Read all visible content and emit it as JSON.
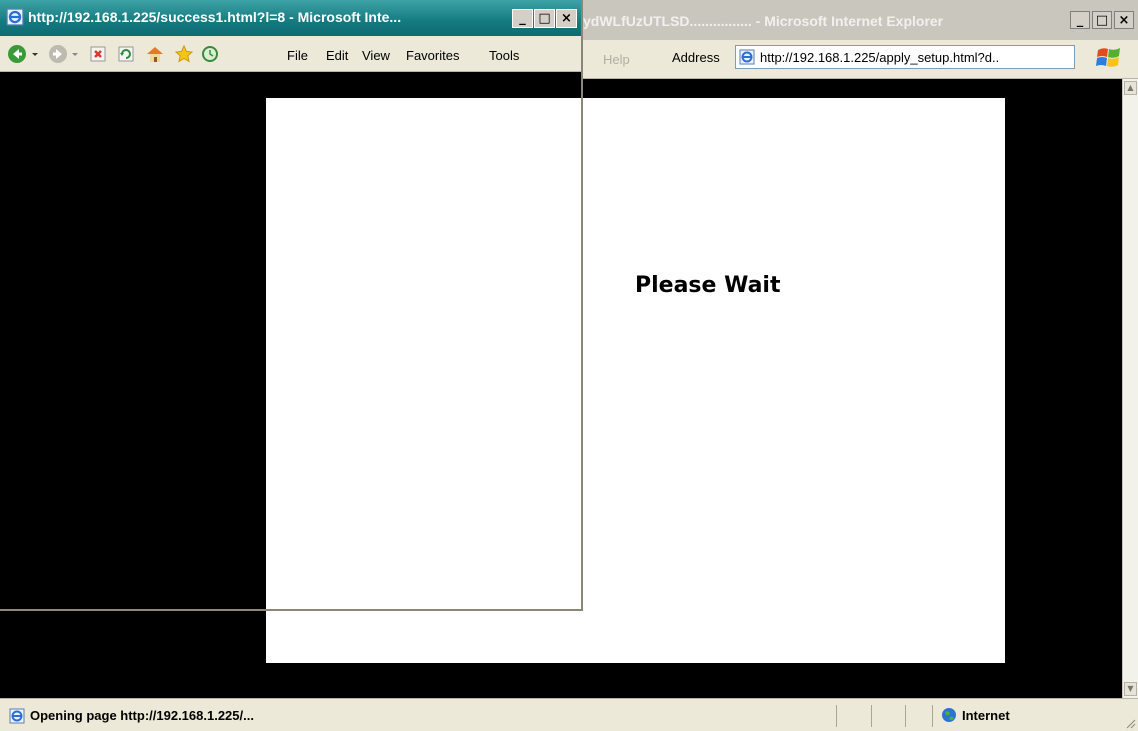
{
  "background_window": {
    "title": "ydWLfUzUTLSD................ - Microsoft Internet Explorer",
    "controls": [
      "_",
      "□",
      "×"
    ],
    "menu": [
      {
        "label": "Help",
        "dim": true
      }
    ],
    "address_label": "Address",
    "address_value": "http://192.168.1.225/apply_setup.html?d..",
    "content_message": "Please Wait",
    "status_text": "Opening page http://192.168.1.225/...",
    "zone_text": "Internet"
  },
  "popup_window": {
    "title": "http://192.168.1.225/success1.html?l=8 - Microsoft Inte...",
    "controls": [
      "_",
      "□",
      "×"
    ],
    "menu": [
      "File",
      "Edit",
      "View",
      "Favorites",
      "Tools"
    ],
    "toolbar_icons": [
      "back-icon",
      "forward-icon",
      "stop-icon",
      "refresh-icon",
      "home-icon",
      "favorites-icon",
      "history-icon"
    ]
  },
  "colors": {
    "popup_title_bar": "#137a80",
    "viewport_bg": "#000000",
    "content_bg": "#ffffff",
    "chrome": "#ece9d8"
  }
}
